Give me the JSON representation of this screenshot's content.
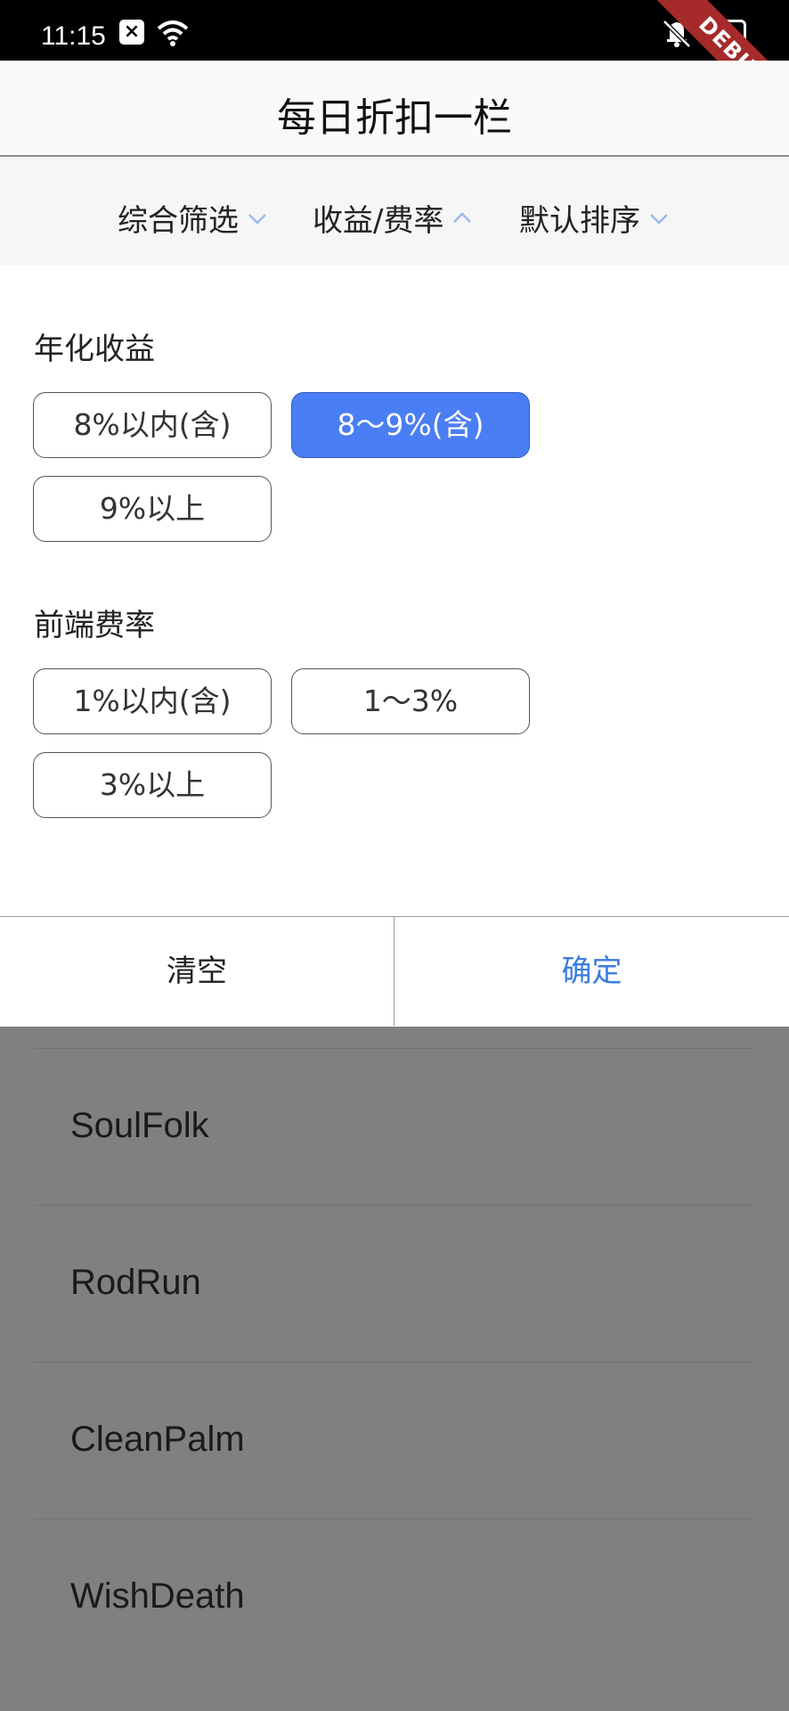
{
  "status_bar": {
    "time": "11:15",
    "debug_label": "DEBUG"
  },
  "app_bar": {
    "title": "每日折扣一栏"
  },
  "filter_tabs": [
    {
      "label": "综合筛选",
      "chevron": "chevron-down-icon"
    },
    {
      "label": "收益/费率",
      "chevron": "chevron-up-icon"
    },
    {
      "label": "默认排序",
      "chevron": "chevron-down-icon"
    }
  ],
  "annual_yield": {
    "title": "年化收益",
    "options": [
      "8%以内(含)",
      "8～9%(含)",
      "9%以上"
    ],
    "selected": "8～9%(含)"
  },
  "front_fee": {
    "title": "前端费率",
    "options": [
      "1%以内(含)",
      "1～3%",
      "3%以上"
    ]
  },
  "actions": {
    "clear": "清空",
    "confirm": "确定"
  },
  "list_items": [
    "SoulFolk",
    "RodRun",
    "CleanPalm",
    "WishDeath"
  ],
  "colors": {
    "accent": "#4a7ef4",
    "confirm_text": "#3b7ddd",
    "overlay": "#808080"
  }
}
